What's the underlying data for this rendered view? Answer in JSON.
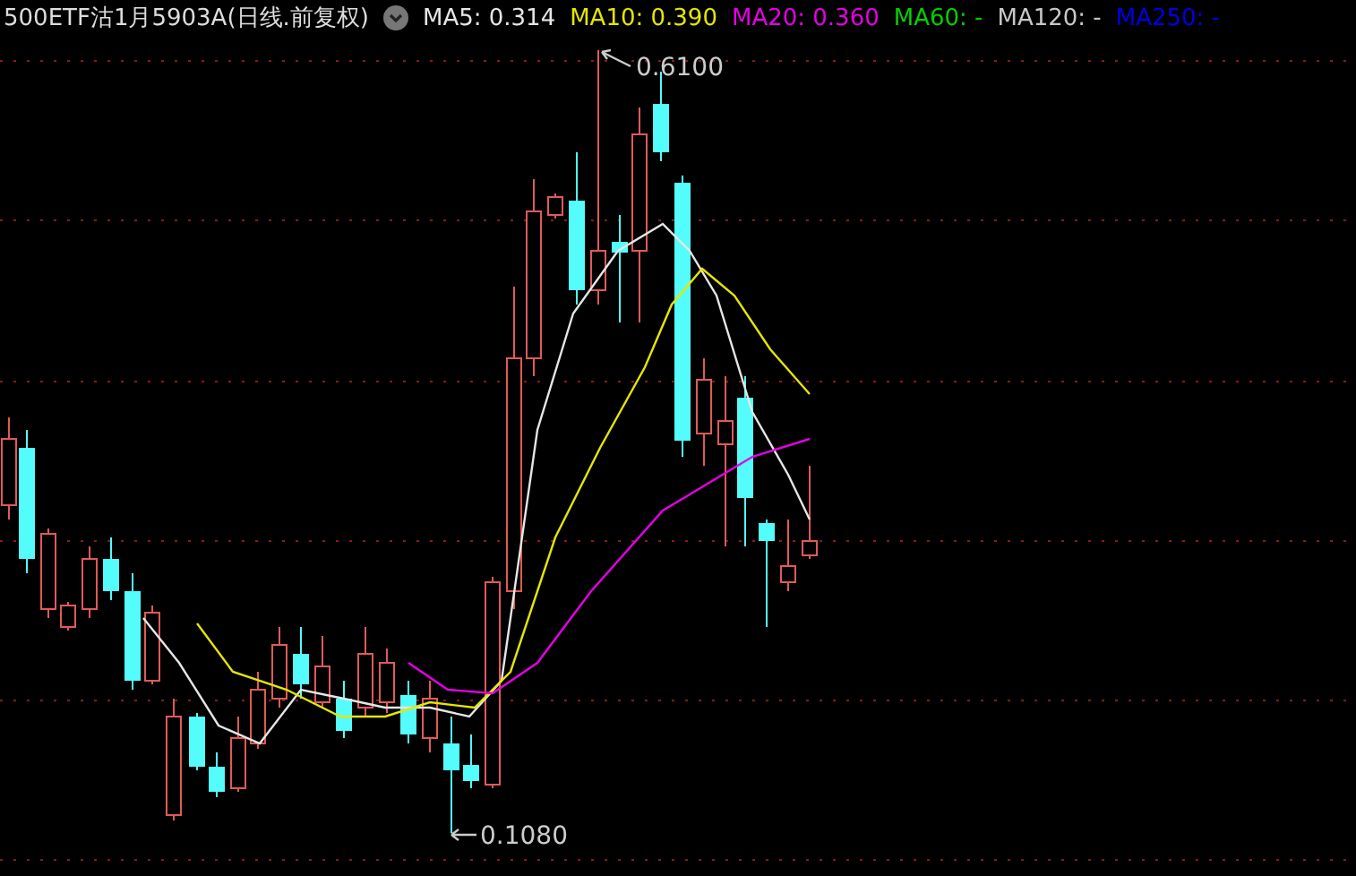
{
  "header": {
    "title": "500ETF沽1月5903A(日线.前复权)",
    "indicators": [
      {
        "label": "MA5: 0.314",
        "color": "#e6e6e6"
      },
      {
        "label": "MA10: 0.390",
        "color": "#e6e600"
      },
      {
        "label": "MA20: 0.360",
        "color": "#e600e6"
      },
      {
        "label": "MA60: -",
        "color": "#00d200"
      },
      {
        "label": "MA120: -",
        "color": "#c8c8c8"
      },
      {
        "label": "MA250: -",
        "color": "#0000e6"
      }
    ]
  },
  "chart": {
    "high_label": "0.6100",
    "low_label": "0.1080"
  }
}
